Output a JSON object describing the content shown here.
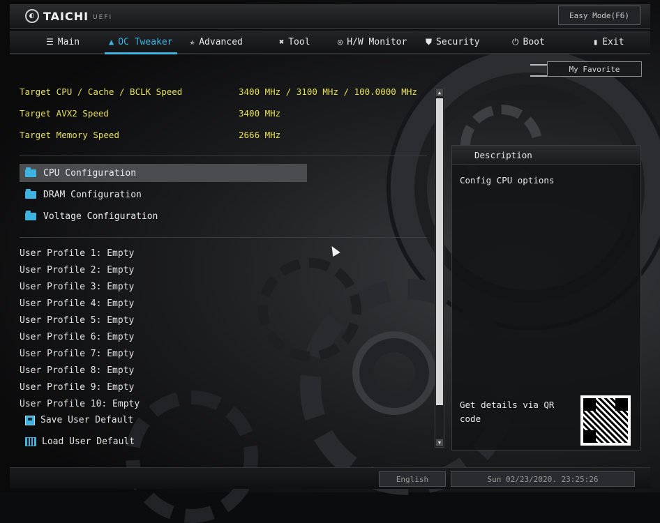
{
  "header": {
    "logo_text": "TAICHI",
    "logo_sub": "UEFI",
    "easy_mode_label": "Easy Mode(F6)"
  },
  "menu": {
    "main": "Main",
    "oc_tweaker": "OC Tweaker",
    "advanced": "Advanced",
    "tool": "Tool",
    "hw_monitor": "H/W Monitor",
    "security": "Security",
    "boot": "Boot",
    "exit": "Exit"
  },
  "favorite_label": "My Favorite",
  "info": [
    {
      "label": "Target CPU / Cache / BCLK Speed",
      "value": "3400 MHz / 3100 MHz / 100.0000 MHz"
    },
    {
      "label": "Target AVX2 Speed",
      "value": "3400 MHz"
    },
    {
      "label": "Target Memory Speed",
      "value": "2666 MHz"
    }
  ],
  "config_items": [
    "CPU Configuration",
    "DRAM Configuration",
    "Voltage Configuration"
  ],
  "profiles": [
    "User Profile 1: Empty",
    "User Profile 2: Empty",
    "User Profile 3: Empty",
    "User Profile 4: Empty",
    "User Profile 5: Empty",
    "User Profile 6: Empty",
    "User Profile 7: Empty",
    "User Profile 8: Empty",
    "User Profile 9: Empty",
    "User Profile 10: Empty"
  ],
  "actions": {
    "save": "Save User Default",
    "load": "Load User Default"
  },
  "description": {
    "title": "Description",
    "text": "Config CPU options",
    "qr_text": "Get details via QR code"
  },
  "footer": {
    "language": "English",
    "datetime": "Sun 02/23/2020. 23:25:26"
  },
  "colors": {
    "accent": "#3fb3e0",
    "value_yellow": "#e7e05a"
  }
}
